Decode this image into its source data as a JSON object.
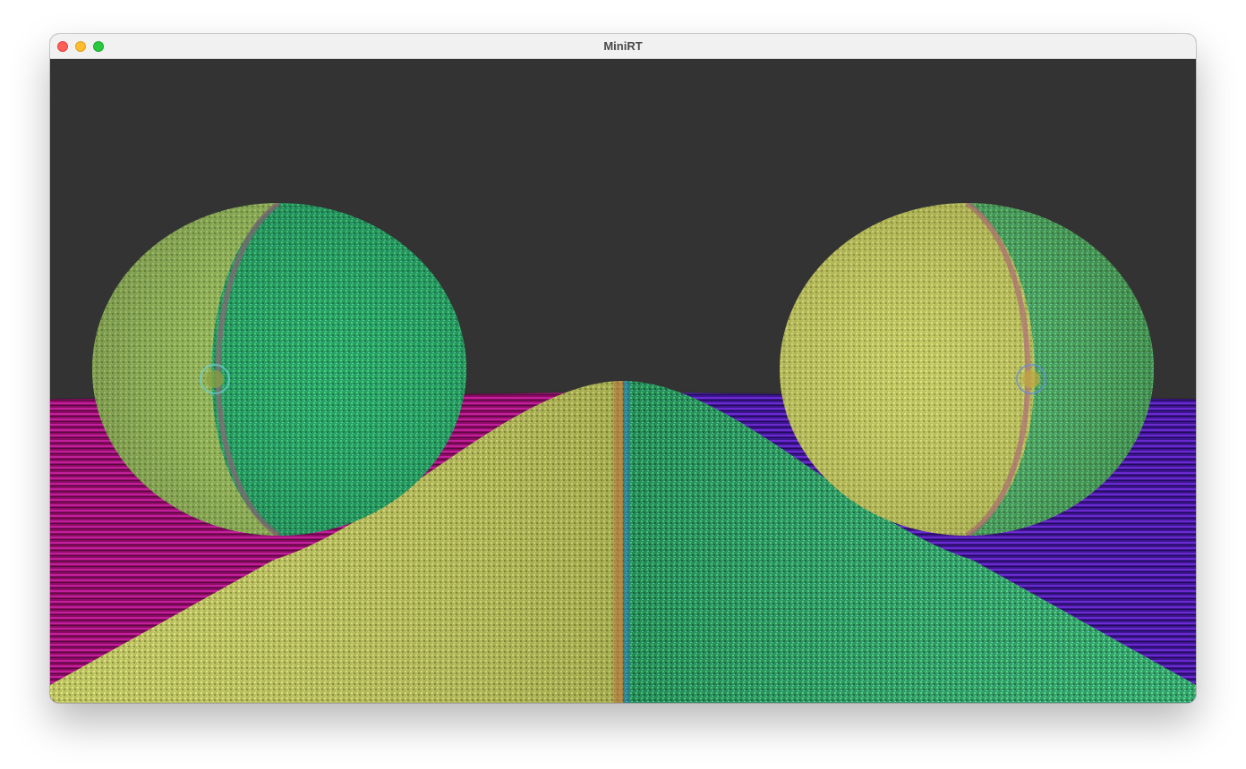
{
  "window": {
    "title": "MiniRT",
    "controls": {
      "close": "close-button",
      "minimize": "minimize-button",
      "maximize": "maximize-button"
    }
  },
  "scene": {
    "background_color": "#333333",
    "floor_left_color": "#9a1070",
    "floor_right_color": "#4a1a9a",
    "sphere_warm_color": "#c2c860",
    "sphere_cool_color": "#2fae6a",
    "objects": [
      "left-sphere",
      "right-sphere",
      "center-hill",
      "floor-plane"
    ]
  }
}
